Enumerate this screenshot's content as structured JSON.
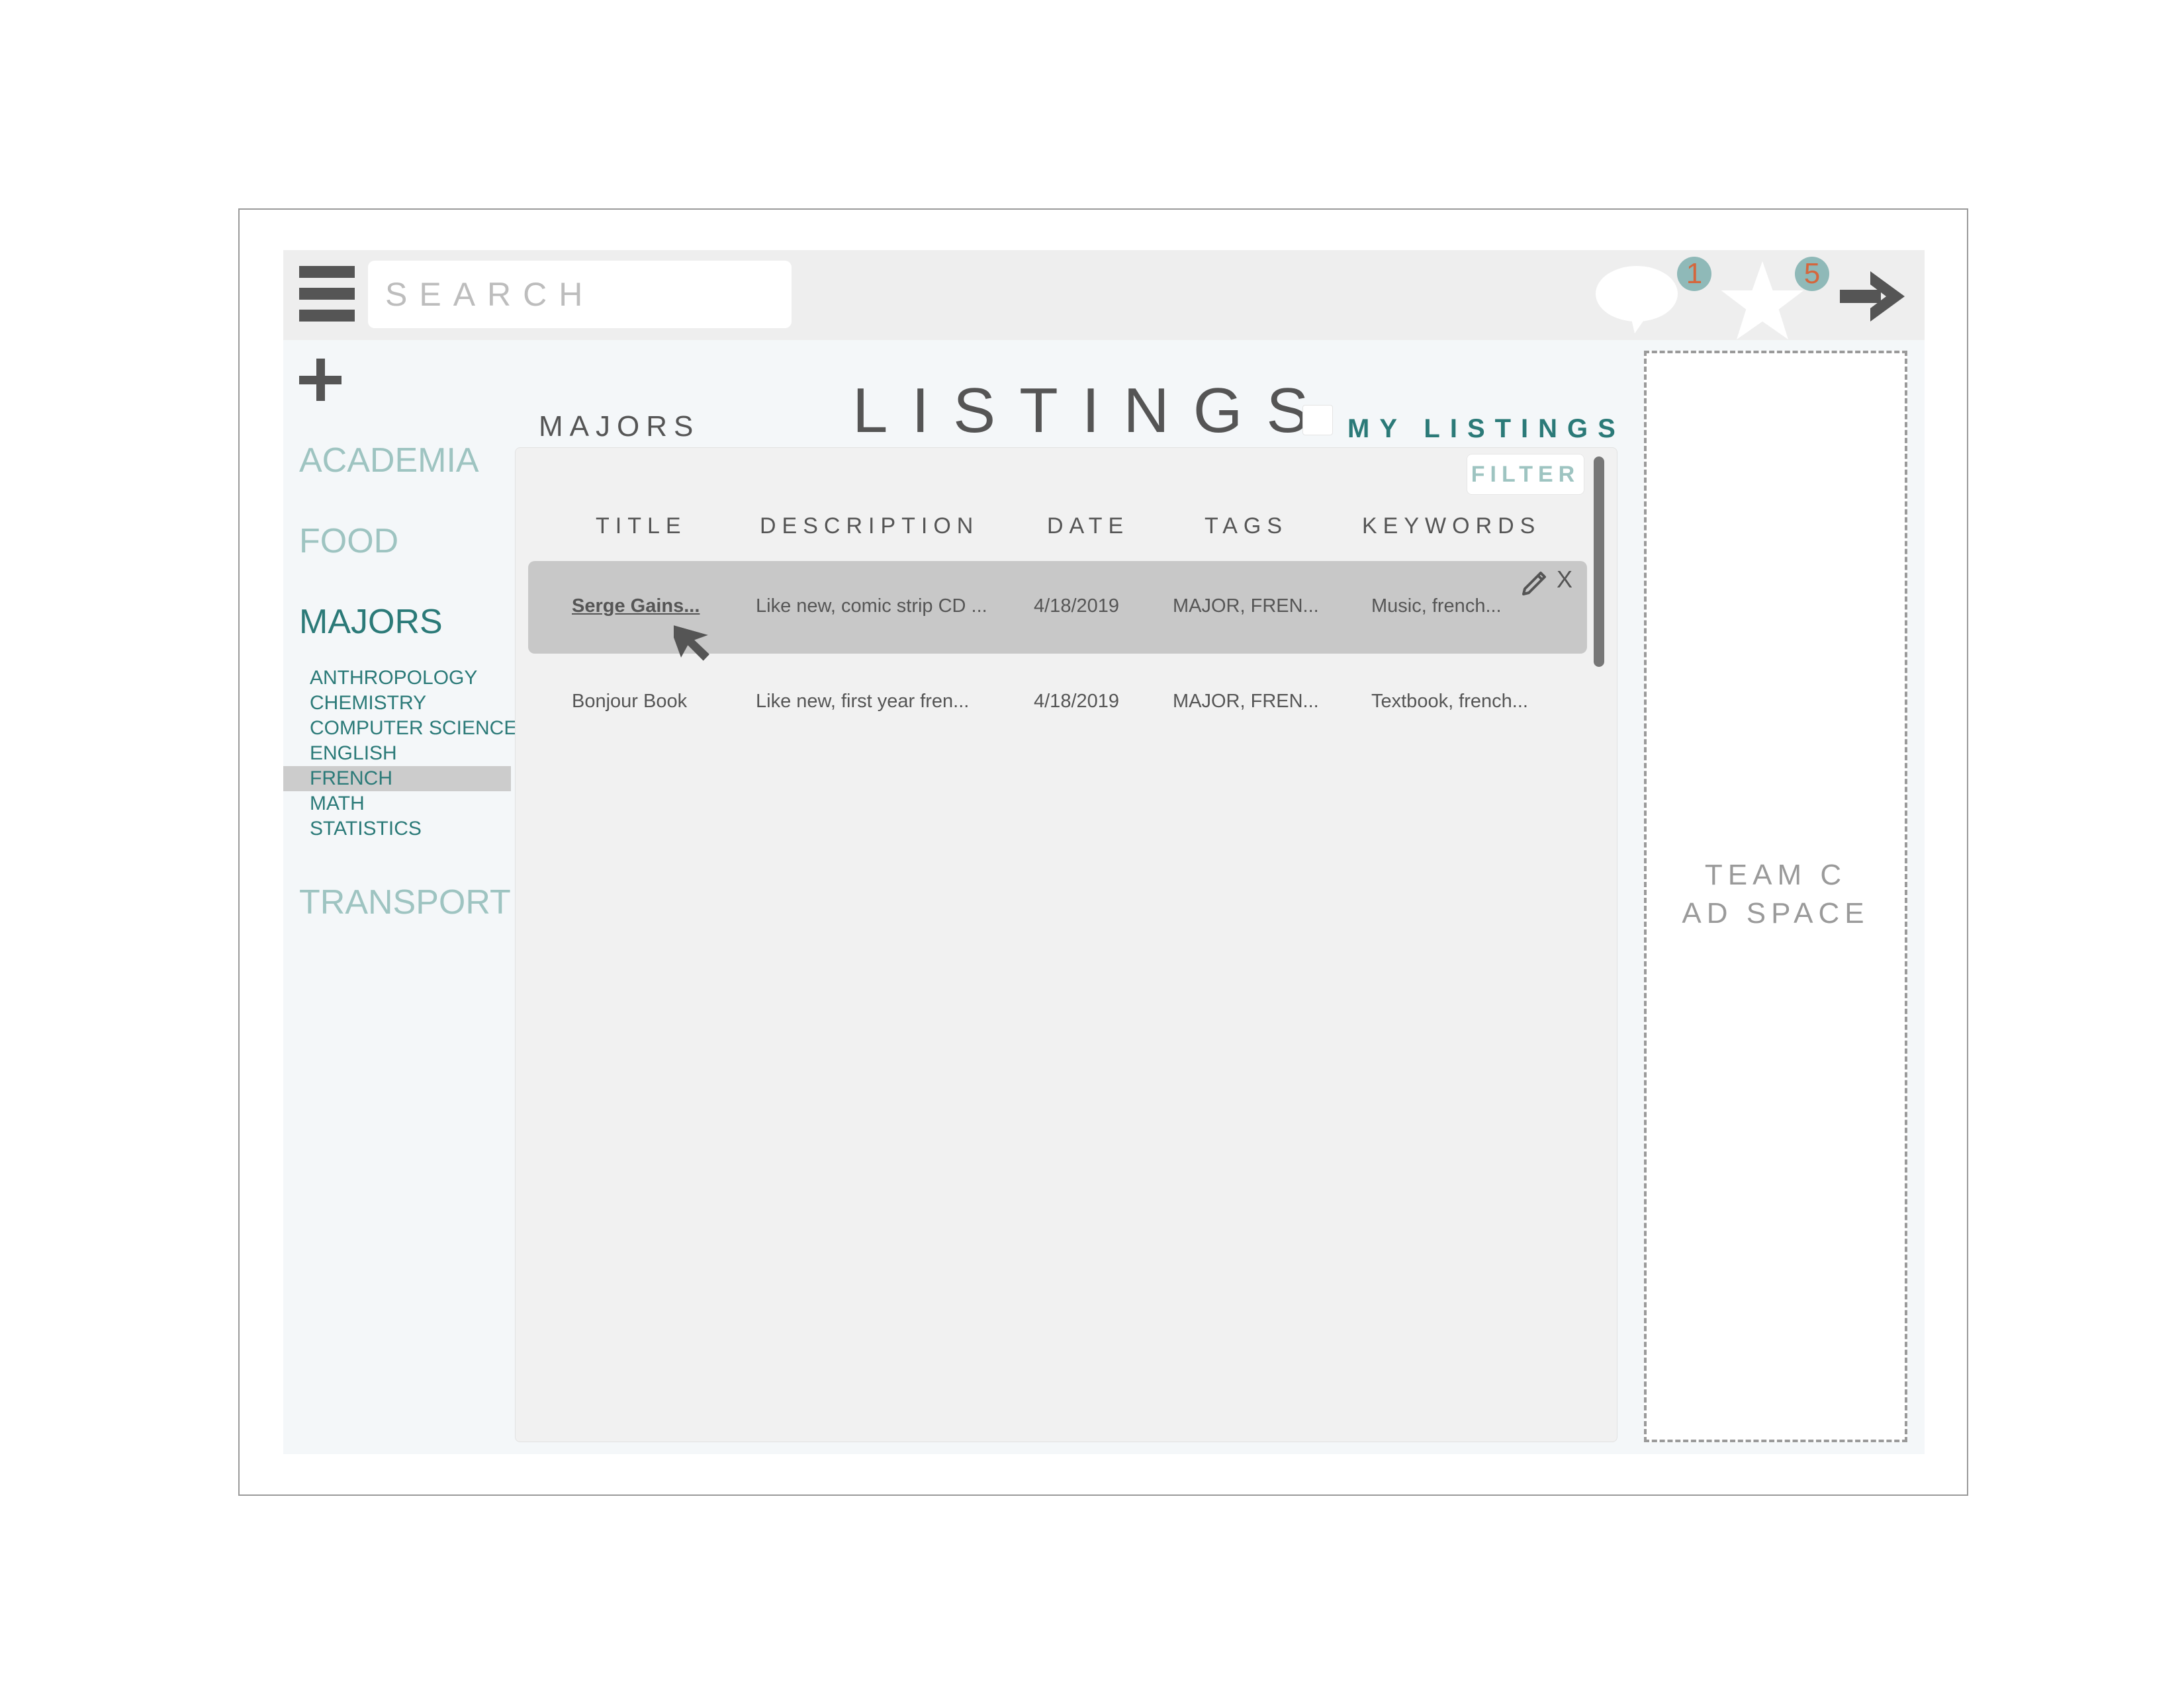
{
  "search": {
    "placeholder": "SEARCH"
  },
  "notifications": {
    "messages_count": "1",
    "favorites_count": "5"
  },
  "sidebar": {
    "categories": [
      "ACADEMIA",
      "FOOD",
      "MAJORS",
      "TRANSPORT"
    ],
    "majors_subcategories": [
      "ANTHROPOLOGY",
      "CHEMISTRY",
      "COMPUTER SCIENCE",
      "ENGLISH",
      "FRENCH",
      "MATH",
      "STATISTICS"
    ],
    "active_subcategory": "FRENCH"
  },
  "main": {
    "section_label": "MAJORS",
    "title": "LISTINGS",
    "my_listings_label": "MY LISTINGS",
    "my_listings_checked": false,
    "filter_label": "FILTER",
    "columns": [
      "TITLE",
      "DESCRIPTION",
      "DATE",
      "TAGS",
      "KEYWORDS"
    ],
    "rows": [
      {
        "title": "Serge Gains...",
        "description": "Like new, comic strip CD ...",
        "date": "4/18/2019",
        "tags": "MAJOR, FREN...",
        "keywords": "Music, french...",
        "delete_label": "X"
      },
      {
        "title": "Bonjour Book",
        "description": "Like new, first year fren...",
        "date": "4/18/2019",
        "tags": "MAJOR, FREN...",
        "keywords": "Textbook, french..."
      }
    ]
  },
  "ad": {
    "line1": "TEAM C",
    "line2": "AD SPACE"
  },
  "colors": {
    "teal": "#2b7a78",
    "teal_light": "#9ec4c1",
    "badge_bg": "#8fb9b8",
    "badge_text": "#d4673d",
    "text_dark": "#555555"
  }
}
